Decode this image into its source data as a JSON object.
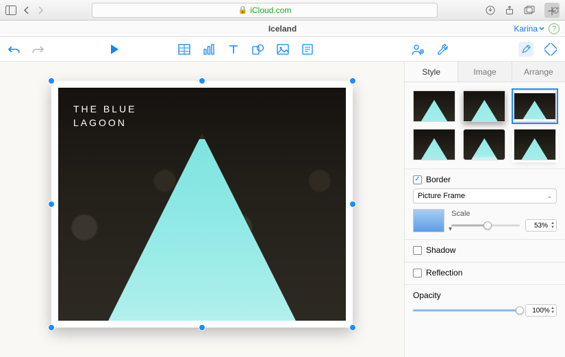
{
  "browser": {
    "url": "iCloud.com"
  },
  "app": {
    "doc_title": "Iceland",
    "user": "Karina"
  },
  "canvas": {
    "caption": "THE BLUE\nLAGOON"
  },
  "inspector": {
    "tabs": [
      "Style",
      "Image",
      "Arrange"
    ],
    "active_tab": 0,
    "border": {
      "label": "Border",
      "checked": true,
      "type": "Picture Frame",
      "scale_label": "Scale",
      "scale_value": "53%",
      "scale_pct": 53
    },
    "shadow": {
      "label": "Shadow",
      "checked": false
    },
    "reflection": {
      "label": "Reflection",
      "checked": false
    },
    "opacity": {
      "label": "Opacity",
      "value": "100%",
      "pct": 100
    }
  }
}
